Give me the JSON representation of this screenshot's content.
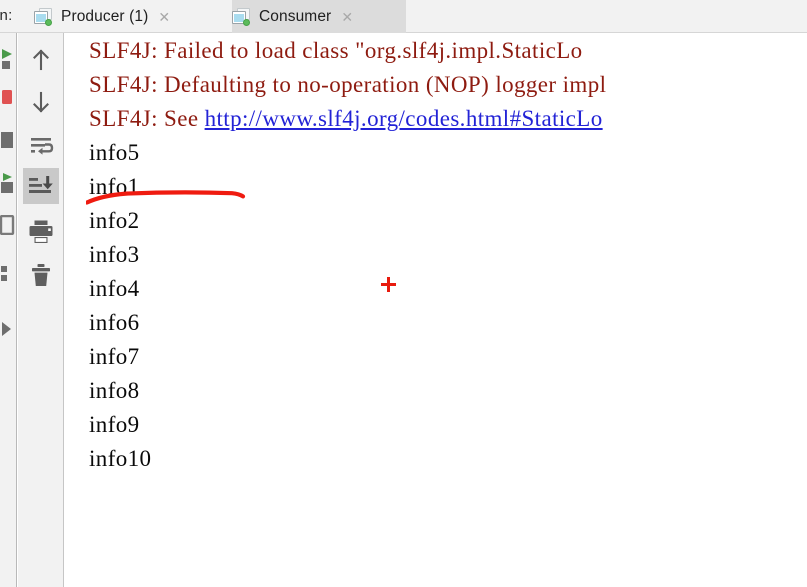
{
  "window": {
    "run_label": "un:",
    "background": "#ffffff",
    "toolbar_background": "#f2f2f2"
  },
  "tabs": {
    "items": [
      {
        "label": "Producer (1)",
        "icon": "console-window-icon",
        "status_dot": "running-green-dot",
        "close_label": "✕",
        "active": false
      },
      {
        "label": "Consumer",
        "icon": "console-window-icon",
        "status_dot": "running-green-dot",
        "close_label": "✕",
        "active": true
      }
    ]
  },
  "toolbar": {
    "buttons": [
      {
        "name": "up-arrow-icon",
        "tooltip": "Up the Stack Trace",
        "active": false
      },
      {
        "name": "down-arrow-icon",
        "tooltip": "Down the Stack Trace",
        "active": false
      },
      {
        "name": "soft-wrap-icon",
        "tooltip": "Soft-Wrap",
        "active": false
      },
      {
        "name": "scroll-to-end-icon",
        "tooltip": "Scroll to the end",
        "active": true
      },
      {
        "name": "print-icon",
        "tooltip": "Print",
        "active": false
      },
      {
        "name": "trash-icon",
        "tooltip": "Clear All",
        "active": false
      }
    ]
  },
  "gutter": {
    "buttons": [
      {
        "name": "rerun-icon",
        "color": "#4a9a4a"
      },
      {
        "name": "stop-icon",
        "color": "#e05252"
      },
      {
        "name": "pause-icon",
        "color": "#6e6e6e"
      },
      {
        "name": "resume-icon",
        "color": "#4a9a4a"
      },
      {
        "name": "frames-icon",
        "color": "#6e6e6e"
      },
      {
        "name": "settings-icon",
        "color": "#6e6e6e"
      },
      {
        "name": "expand-icon",
        "color": "#6e6e6e"
      }
    ]
  },
  "console": {
    "lines": [
      {
        "kind": "warn",
        "text": "SLF4J: Failed to load class \"org.slf4j.impl.StaticLo"
      },
      {
        "kind": "warn",
        "text": "SLF4J: Defaulting to no-operation (NOP) logger impl"
      },
      {
        "kind": "warn",
        "prefix": "SLF4J: See ",
        "link": "http://www.slf4j.org/codes.html#StaticLo"
      },
      {
        "kind": "out",
        "text": "info5"
      },
      {
        "kind": "out",
        "text": "info1"
      },
      {
        "kind": "out",
        "text": "info2"
      },
      {
        "kind": "out",
        "text": "info3"
      },
      {
        "kind": "out",
        "text": "info4"
      },
      {
        "kind": "out",
        "text": "info6"
      },
      {
        "kind": "out",
        "text": "info7"
      },
      {
        "kind": "out",
        "text": "info8"
      },
      {
        "kind": "out",
        "text": "info9"
      },
      {
        "kind": "out",
        "text": "info10"
      }
    ]
  },
  "annotations": {
    "underline": {
      "name": "red-underline-annotation",
      "color": "#ef1b10",
      "target": "info5"
    },
    "cursor_marker": {
      "name": "red-plus-cursor-marker",
      "color": "#e81b0e"
    }
  }
}
